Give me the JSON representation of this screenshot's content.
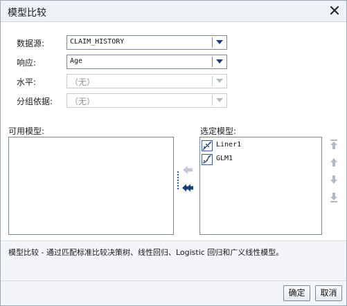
{
  "dialog": {
    "title": "模型比较",
    "close_icon": "close-icon"
  },
  "form": {
    "data_source": {
      "label": "数据源:",
      "value": "CLAIM_HISTORY"
    },
    "response": {
      "label": "响应:",
      "value": "Age"
    },
    "level": {
      "label": "水平:",
      "value": "（无）"
    },
    "group_by": {
      "label": "分组依据:",
      "value": "（无）"
    }
  },
  "available_models": {
    "label": "可用模型:",
    "items": []
  },
  "selected_models": {
    "label": "选定模型:",
    "items": [
      {
        "label": "Liner1",
        "icon": "linear-regression-icon"
      },
      {
        "label": "GLM1",
        "icon": "glm-icon"
      }
    ]
  },
  "description": "模型比较 - 通过匹配标准比较决策树、线性回归、Logistic 回归和广义线性模型。",
  "buttons": {
    "ok": "确定",
    "cancel": "取消"
  },
  "colors": {
    "accent": "#1c3f7a",
    "titlebar": "#eef2f7",
    "footer": "#f3f5f8"
  }
}
